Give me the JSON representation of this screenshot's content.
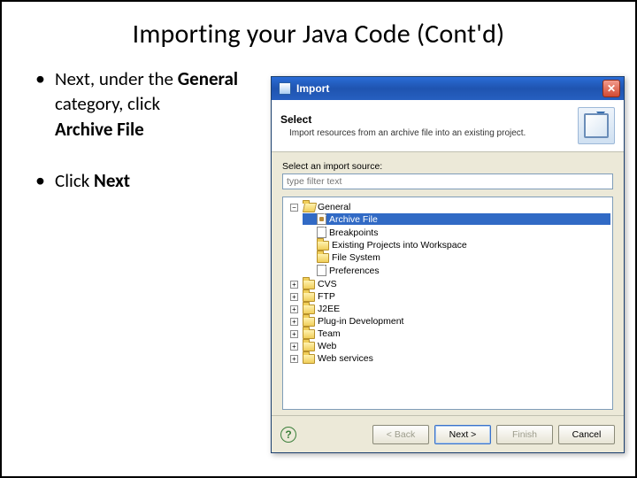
{
  "slide": {
    "title": "Importing your Java Code (Cont'd)",
    "bullet1_a": "Next, under the ",
    "bullet1_b": "General",
    "bullet1_c": "category, click",
    "bullet1_d": "Archive File",
    "bullet2_a": "Click ",
    "bullet2_b": "Next"
  },
  "dialog": {
    "title": "Import",
    "banner_heading": "Select",
    "banner_sub": "Import resources from an archive file into an existing project.",
    "filter_label": "Select an import source:",
    "filter_placeholder": "type filter text",
    "tree": {
      "expanded": {
        "label": "General",
        "children": [
          {
            "label": "Archive File",
            "icon": "archive",
            "selected": true
          },
          {
            "label": "Breakpoints",
            "icon": "file"
          },
          {
            "label": "Existing Projects into Workspace",
            "icon": "folder"
          },
          {
            "label": "File System",
            "icon": "folder"
          },
          {
            "label": "Preferences",
            "icon": "file"
          }
        ]
      },
      "collapsed": [
        {
          "label": "CVS"
        },
        {
          "label": "FTP"
        },
        {
          "label": "J2EE"
        },
        {
          "label": "Plug-in Development"
        },
        {
          "label": "Team"
        },
        {
          "label": "Web"
        },
        {
          "label": "Web services"
        }
      ]
    },
    "buttons": {
      "back": "< Back",
      "next": "Next >",
      "finish": "Finish",
      "cancel": "Cancel"
    },
    "help": "?"
  }
}
